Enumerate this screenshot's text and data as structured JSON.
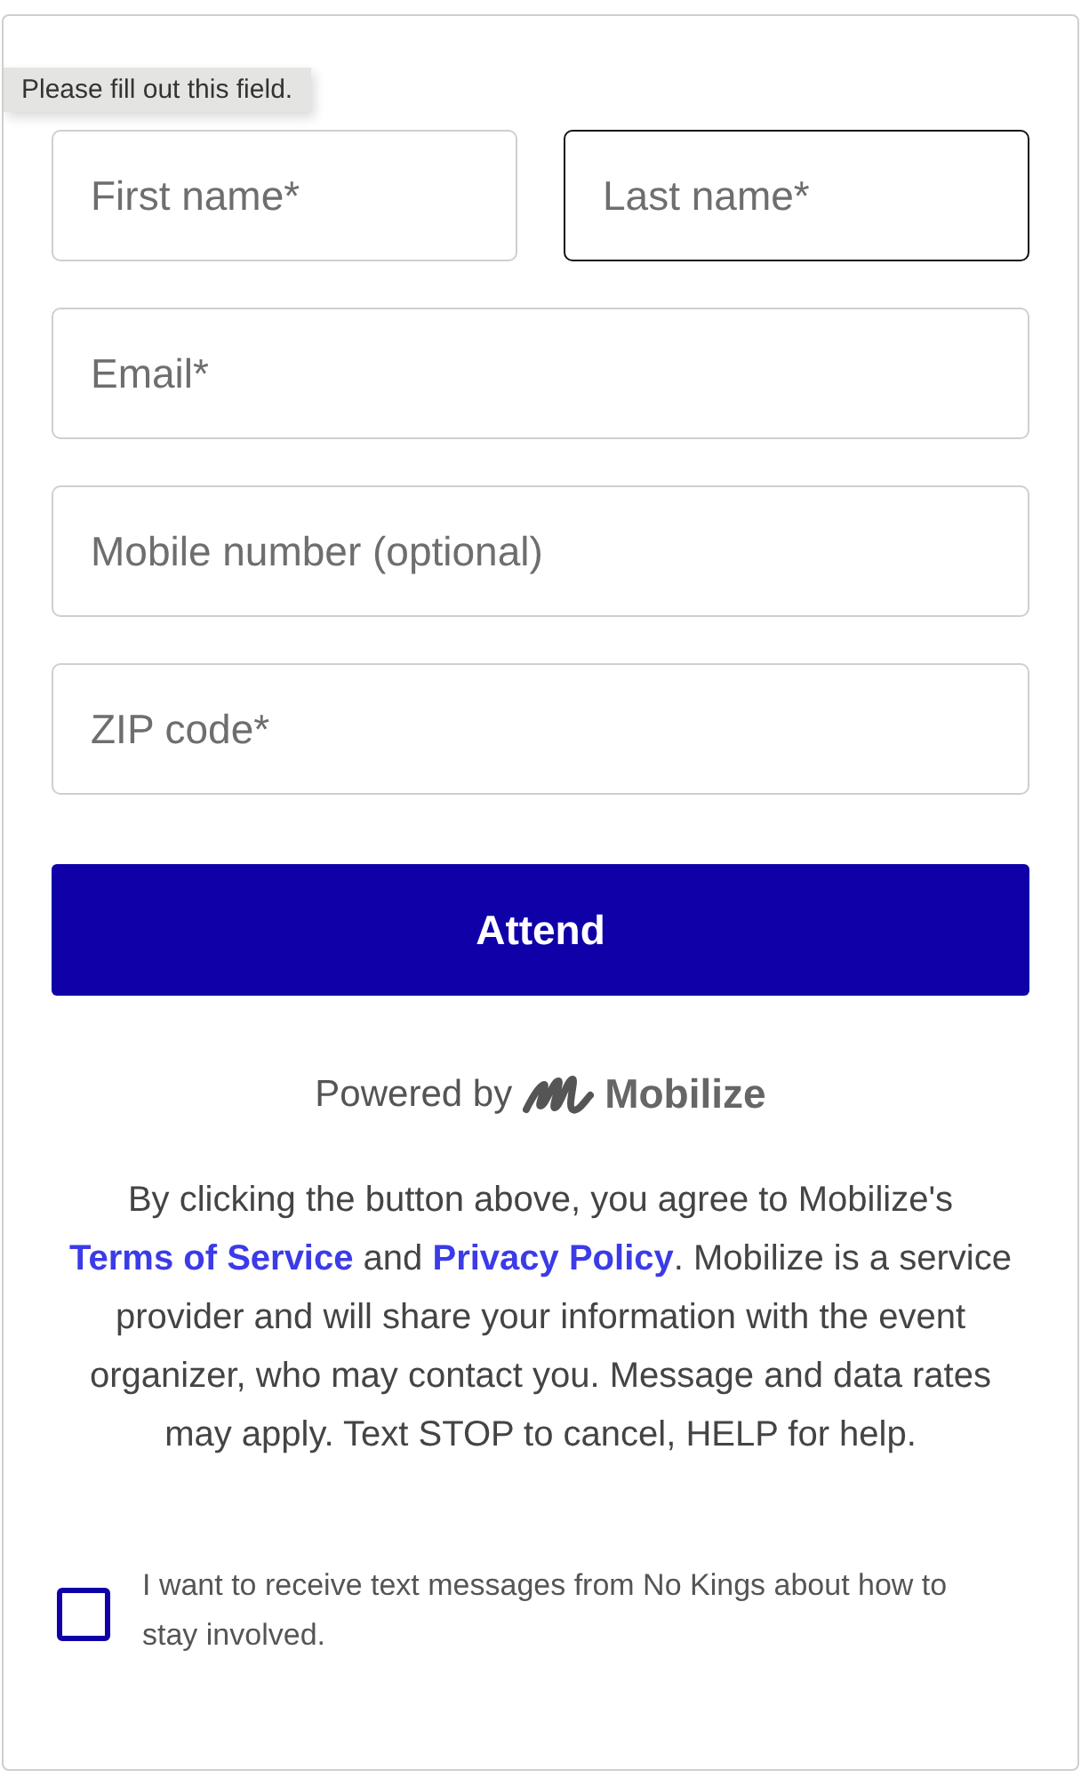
{
  "tooltip": "Please fill out this field.",
  "fields": [
    {
      "placeholder": "First name*",
      "focused": false,
      "half": true
    },
    {
      "placeholder": "Last name*",
      "focused": true,
      "half": true
    },
    {
      "placeholder": "Email*",
      "focused": false,
      "half": false
    },
    {
      "placeholder": "Mobile number (optional)",
      "focused": false,
      "half": false
    },
    {
      "placeholder": "ZIP code*",
      "focused": false,
      "half": false
    }
  ],
  "submit": "Attend",
  "powered_by": {
    "prefix": "Powered by",
    "brand": "Mobilize"
  },
  "disclaimer": [
    {
      "kind": "text",
      "text": "By clicking the button above, you agree to Mobilize's "
    },
    {
      "kind": "link",
      "text": "Terms of Service"
    },
    {
      "kind": "text",
      "text": " and "
    },
    {
      "kind": "link",
      "text": "Privacy Policy"
    },
    {
      "kind": "text",
      "text": ". Mobilize is a service provider and will share your information with the event organizer, who may contact you. Message and data rates may apply. Text STOP to cancel, HELP for help."
    }
  ],
  "opt_in": {
    "label": "I want to receive text messages from No Kings about how to stay involved.",
    "checked": false
  }
}
